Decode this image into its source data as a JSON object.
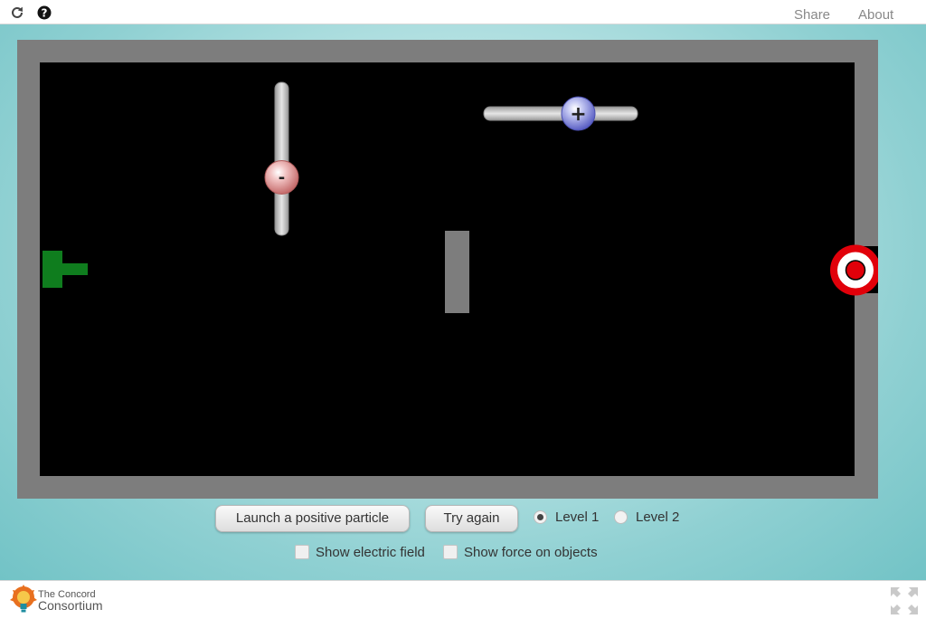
{
  "topbar": {
    "icons": [
      "reload-icon",
      "help-icon"
    ],
    "links": {
      "share": "Share",
      "about": "About"
    }
  },
  "simulation": {
    "negative_charge_symbol": "-",
    "positive_charge_symbol": "+",
    "colors": {
      "background": "#000000",
      "frame": "#7d7d7d",
      "launcher": "#0f7d1e",
      "target_red": "#e1000a",
      "obstacle": "#7d7d7d"
    }
  },
  "controls": {
    "launch_button": "Launch a positive particle",
    "try_again_button": "Try again",
    "levels": [
      {
        "label": "Level 1",
        "selected": true
      },
      {
        "label": "Level 2",
        "selected": false
      }
    ],
    "checkboxes": [
      {
        "label": "Show electric field",
        "checked": false
      },
      {
        "label": "Show force on objects",
        "checked": false
      }
    ]
  },
  "footer": {
    "logo_line1": "The Concord",
    "logo_line2": "Consortium",
    "icons": [
      "concord-logo-icon",
      "fullscreen-icon"
    ]
  }
}
